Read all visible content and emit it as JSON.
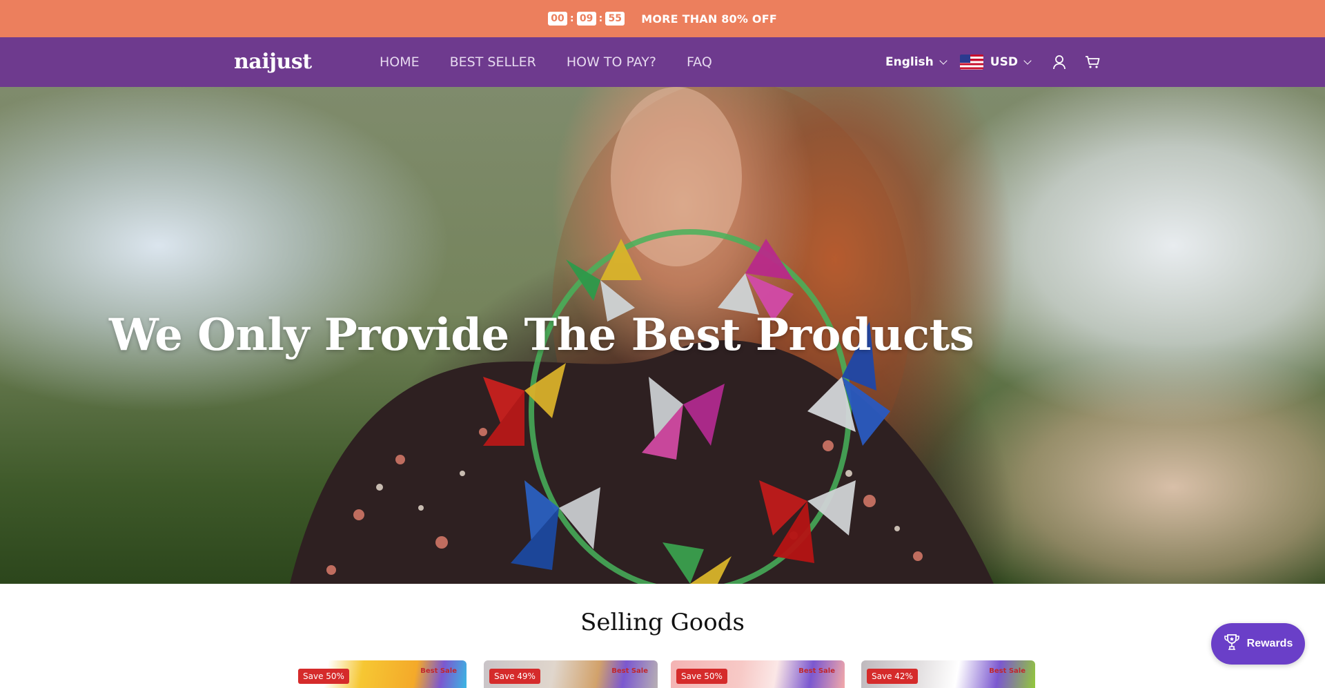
{
  "announcement": {
    "timer": {
      "hours": "00",
      "minutes": "09",
      "seconds": "55"
    },
    "text": "MORE THAN 80% OFF",
    "bg_color": "#ec7f5d"
  },
  "header": {
    "logo": "naijust",
    "bg_color": "#6e3a8e",
    "nav": [
      "HOME",
      "BEST SELLER",
      "HOW TO PAY?",
      "FAQ"
    ],
    "language": "English",
    "currency": "USD",
    "icons": [
      "user-icon",
      "cart-icon"
    ]
  },
  "hero": {
    "title": "We Only Provide The Best Products"
  },
  "selling": {
    "title": "Selling Goods",
    "products": [
      {
        "badge": "Save 50%",
        "tag": "Best Sale"
      },
      {
        "badge": "Save 49%",
        "tag": "Best Sale"
      },
      {
        "badge": "Save 50%",
        "tag": "Best Sale"
      },
      {
        "badge": "Save 42%",
        "tag": "Best Sale"
      }
    ]
  },
  "rewards": {
    "label": "Rewards",
    "color": "#6a3fc8"
  }
}
